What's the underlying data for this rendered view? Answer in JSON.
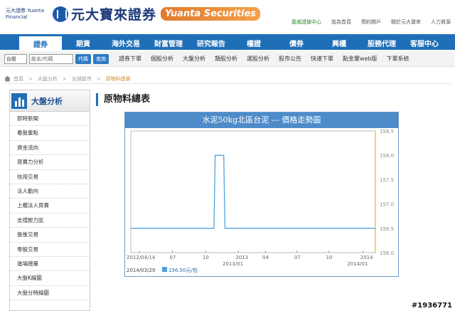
{
  "header": {
    "logo_small": "元大證券 Yuanta Financial",
    "logo_main": "元大寶來證券",
    "logo_en": "Yuanta Securities",
    "links": [
      "嘉威證據中心",
      "設為首頁",
      "預約開戶",
      "關於元大寶來",
      "人力資源"
    ]
  },
  "nav": {
    "main": [
      "證券",
      "期貨",
      "海外交易",
      "財富管理",
      "研究報告",
      "權證",
      "債券",
      "興櫃",
      "股務代理",
      "客服中心"
    ],
    "active": "證券"
  },
  "search": {
    "market_select": "台股",
    "input_placeholder": "股名/代碼",
    "code_button": "代碼",
    "query_button": "查詢"
  },
  "subnav": [
    "證券下單",
    "個股分析",
    "大盤分析",
    "類股分析",
    "選股分析",
    "股市公告",
    "快速下單",
    "點金靈web版",
    "下單系統"
  ],
  "breadcrumb": [
    "首頁",
    "大盤分析",
    "全球股市",
    "原物料總表"
  ],
  "sidebar": {
    "title": "大盤分析",
    "items": [
      "即時新聞",
      "看盤重點",
      "資金流向",
      "買賣力分析",
      "信用交易",
      "法人動向",
      "上櫃法人買賣",
      "支撐壓力區",
      "盤後交易",
      "零股交易",
      "進場總量",
      "大盤K線圖",
      "大盤分時線圖"
    ]
  },
  "content": {
    "title": "原物料總表"
  },
  "chart_data": {
    "type": "line",
    "title": "水泥50kg北區台泥 --- 價格走勢圖",
    "x_labels": [
      "2012/04/14",
      "07",
      "10",
      "2013",
      "04",
      "07",
      "10",
      "2014"
    ],
    "x_labels_row2": [
      "2013/01",
      "2014/01"
    ],
    "yticks": [
      "158.5",
      "158.0",
      "157.5",
      "157.0",
      "156.5",
      "156.0"
    ],
    "ylim": [
      156.0,
      158.5
    ],
    "series": [
      {
        "x": [
          0,
          0.34,
          0.345,
          0.38,
          0.385,
          1.0
        ],
        "y": [
          156.5,
          156.5,
          158.0,
          158.0,
          156.5,
          156.5
        ]
      }
    ],
    "date_label": "2014/03/29",
    "latest_label": "156.50元/包",
    "color": "#4fa3e0"
  },
  "watermark": "#1936771"
}
